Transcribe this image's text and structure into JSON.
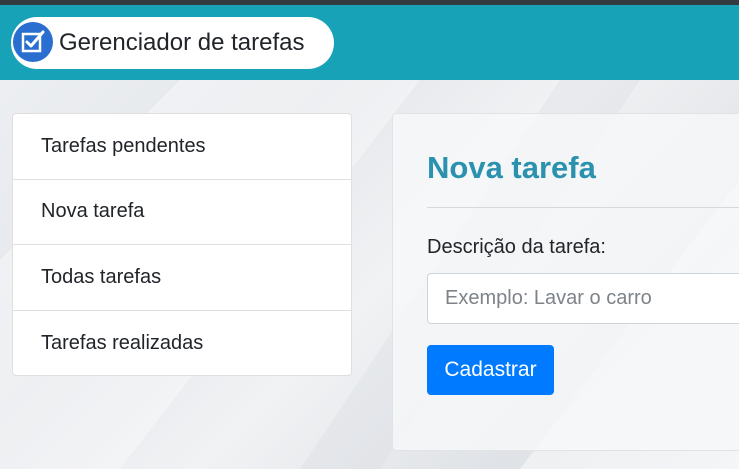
{
  "app": {
    "title": "Gerenciador de tarefas",
    "logo_icon": "checkbox-icon",
    "navbar_color": "#17a2b8",
    "logo_color": "#2a6fd0"
  },
  "sidebar": {
    "items": [
      {
        "label": "Tarefas pendentes"
      },
      {
        "label": "Nova tarefa"
      },
      {
        "label": "Todas tarefas"
      },
      {
        "label": "Tarefas realizadas"
      }
    ]
  },
  "form": {
    "title": "Nova tarefa",
    "title_color": "#2a91ae",
    "description_label": "Descrição da tarefa:",
    "description_placeholder": "Exemplo: Lavar o carro",
    "description_value": "",
    "submit_label": "Cadastrar",
    "submit_color": "#007bff"
  }
}
